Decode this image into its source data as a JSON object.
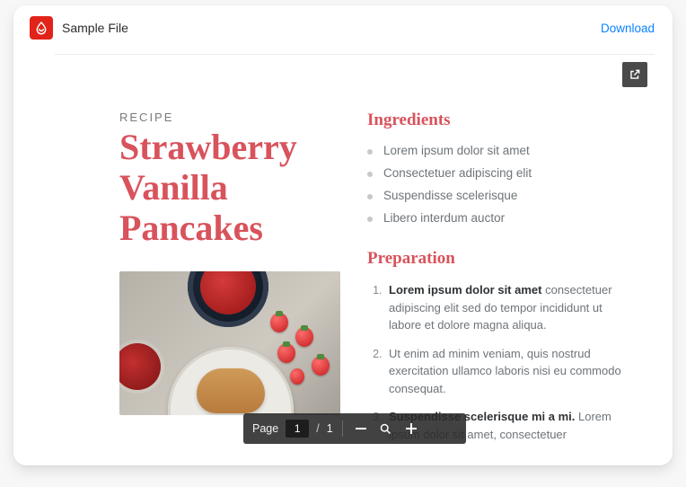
{
  "header": {
    "file_name": "Sample File",
    "download_label": "Download"
  },
  "toolbar": {
    "page_label": "Page",
    "current_page": "1",
    "page_separator": "/",
    "total_pages": "1"
  },
  "document": {
    "eyebrow": "RECIPE",
    "title": "Strawberry Vanilla Pancakes",
    "ingredients_heading": "Ingredients",
    "ingredients": [
      "Lorem ipsum dolor sit amet",
      "Consectetuer adipiscing elit",
      "Suspendisse scelerisque",
      "Libero interdum auctor"
    ],
    "preparation_heading": "Preparation",
    "preparation": [
      {
        "lead": "Lorem ipsum dolor sit amet",
        "rest": " consectetuer adipiscing elit sed do tempor incididunt ut labore et dolore magna aliqua."
      },
      {
        "lead": "",
        "rest": "Ut enim ad minim veniam, quis nostrud exercitation ullamco laboris nisi eu commodo consequat."
      },
      {
        "lead": "Suspendisse scelerisque mi a mi.",
        "rest": " Lorem ipsum dolor sit amet, consectetuer"
      }
    ]
  },
  "colors": {
    "accent": "#d8535c",
    "pdf_red": "#e2231a",
    "link": "#0a84ff"
  }
}
